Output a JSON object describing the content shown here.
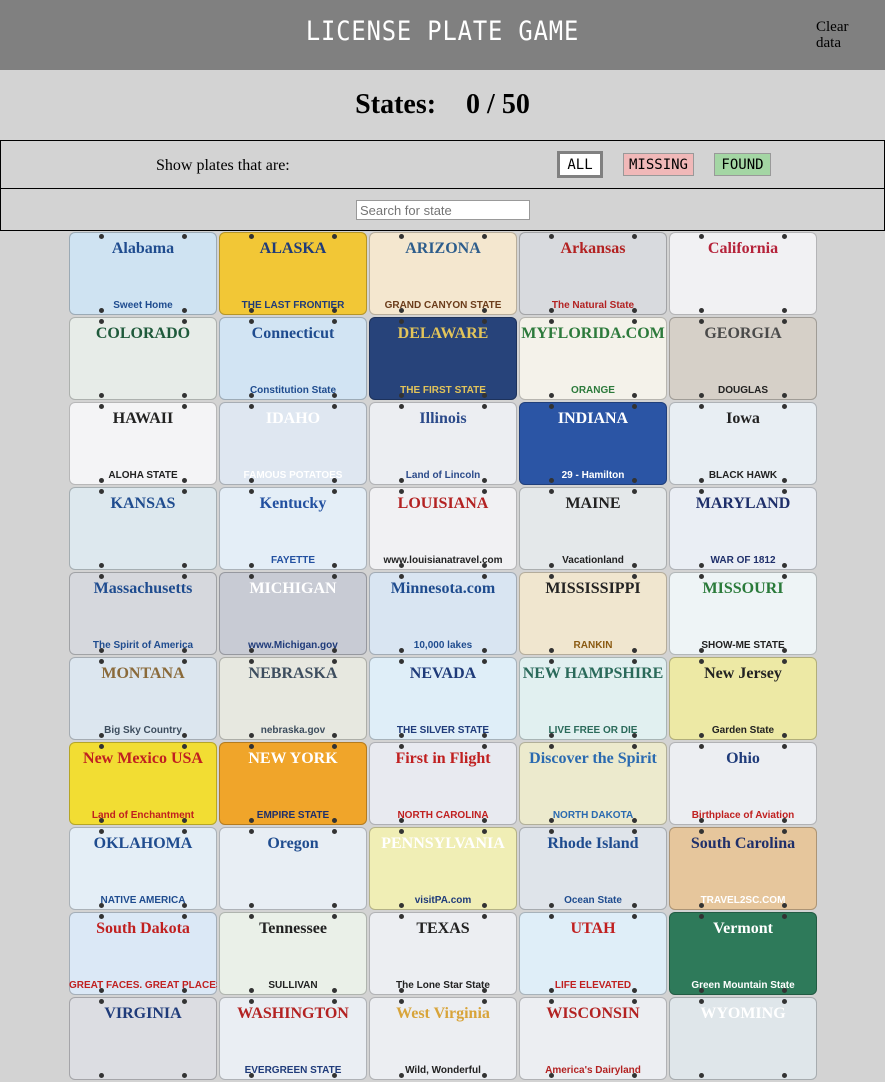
{
  "header": {
    "title": "License Plate Game",
    "clear_label": "Clear data"
  },
  "counter": {
    "label": "States:",
    "value": "0 / 50"
  },
  "filter": {
    "label": "Show plates that are:",
    "options": [
      {
        "label": "ALL"
      },
      {
        "label": "MISSING"
      },
      {
        "label": "FOUND"
      }
    ],
    "selected": "ALL"
  },
  "search": {
    "placeholder": "Search for state",
    "value": ""
  },
  "plates": [
    {
      "name": "Alabama",
      "slogan": "Sweet Home",
      "bg": "#cfe3f2",
      "fg": "#1f4c8f",
      "sc": "#1f4c8f"
    },
    {
      "name": "ALASKA",
      "slogan": "THE LAST FRONTIER",
      "bg": "#f2c736",
      "fg": "#1f3b7a",
      "sc": "#1f3b7a"
    },
    {
      "name": "ARIZONA",
      "slogan": "GRAND CANYON STATE",
      "bg": "#f4e7cf",
      "fg": "#2d5d8c",
      "sc": "#6b3c1a"
    },
    {
      "name": "Arkansas",
      "slogan": "The Natural State",
      "bg": "#d8dade",
      "fg": "#b32222",
      "sc": "#b32222"
    },
    {
      "name": "California",
      "slogan": "",
      "bg": "#f1f1f3",
      "fg": "#b5233a",
      "sc": "#1e3d8a"
    },
    {
      "name": "COLORADO",
      "slogan": "",
      "bg": "#e7ece8",
      "fg": "#1f5a3b",
      "sc": "#1f5a3b"
    },
    {
      "name": "Connecticut",
      "slogan": "Constitution State",
      "bg": "#d2e4f3",
      "fg": "#1f4c8f",
      "sc": "#1f4c8f"
    },
    {
      "name": "DELAWARE",
      "slogan": "THE FIRST STATE",
      "bg": "#27437a",
      "fg": "#e2c45a",
      "sc": "#e2c45a"
    },
    {
      "name": "MYFLORIDA.COM",
      "slogan": "ORANGE",
      "bg": "#f4f2ea",
      "fg": "#2c7a3b",
      "sc": "#2c7a3b"
    },
    {
      "name": "GEORGIA",
      "slogan": "DOUGLAS",
      "bg": "#d6d0c8",
      "fg": "#4a4a4a",
      "sc": "#222222"
    },
    {
      "name": "HAWAII",
      "slogan": "ALOHA STATE",
      "bg": "#f4f4f6",
      "fg": "#222222",
      "sc": "#222222"
    },
    {
      "name": "IDAHO",
      "slogan": "FAMOUS POTATOES",
      "bg": "#dfe7f1",
      "fg": "#ffffff",
      "sc": "#ffffff"
    },
    {
      "name": "Illinois",
      "slogan": "Land of Lincoln",
      "bg": "#eceef2",
      "fg": "#2b4a8a",
      "sc": "#2b4a8a"
    },
    {
      "name": "INDIANA",
      "slogan": "29 - Hamilton",
      "bg": "#2b55a5",
      "fg": "#ffffff",
      "sc": "#ffffff"
    },
    {
      "name": "Iowa",
      "slogan": "BLACK HAWK",
      "bg": "#e8eef3",
      "fg": "#222222",
      "sc": "#222222"
    },
    {
      "name": "KANSAS",
      "slogan": "",
      "bg": "#dde8ee",
      "fg": "#1f4c8f",
      "sc": "#1f4c8f"
    },
    {
      "name": "Kentucky",
      "slogan": "FAYETTE",
      "bg": "#e4eef7",
      "fg": "#2250a0",
      "sc": "#2250a0"
    },
    {
      "name": "LOUISIANA",
      "slogan": "www.louisianatravel.com",
      "bg": "#f1f1f3",
      "fg": "#b32222",
      "sc": "#222222"
    },
    {
      "name": "MAINE",
      "slogan": "Vacationland",
      "bg": "#e4e8ea",
      "fg": "#222222",
      "sc": "#222222"
    },
    {
      "name": "MARYLAND",
      "slogan": "WAR OF 1812",
      "bg": "#eaeef4",
      "fg": "#1f2f6a",
      "sc": "#1f2f6a"
    },
    {
      "name": "Massachusetts",
      "slogan": "The Spirit of America",
      "bg": "#d6d8dd",
      "fg": "#1f4c8f",
      "sc": "#1f4c8f"
    },
    {
      "name": "MICHIGAN",
      "slogan": "www.Michigan.gov",
      "bg": "#c8cbd4",
      "fg": "#ffffff",
      "sc": "#1f3b7a"
    },
    {
      "name": "Minnesota.com",
      "slogan": "10,000 lakes",
      "bg": "#d9e5f2",
      "fg": "#1f4c8f",
      "sc": "#1f4c8f"
    },
    {
      "name": "MISSISSIPPI",
      "slogan": "RANKIN",
      "bg": "#f0e6cf",
      "fg": "#222222",
      "sc": "#8a5a12"
    },
    {
      "name": "MISSOURI",
      "slogan": "SHOW-ME STATE",
      "bg": "#eef4f6",
      "fg": "#2a7a3a",
      "sc": "#222222"
    },
    {
      "name": "MONTANA",
      "slogan": "Big Sky Country",
      "bg": "#dce6ef",
      "fg": "#8a6a3a",
      "sc": "#3d4d5e"
    },
    {
      "name": "NEBRASKA",
      "slogan": "nebraska.gov",
      "bg": "#e7e8e0",
      "fg": "#3d4d5e",
      "sc": "#3d4d5e"
    },
    {
      "name": "NEVADA",
      "slogan": "THE SILVER STATE",
      "bg": "#dfeef8",
      "fg": "#1f3b7a",
      "sc": "#1f3b7a"
    },
    {
      "name": "NEW HAMPSHIRE",
      "slogan": "LIVE FREE OR DIE",
      "bg": "#e1f0f0",
      "fg": "#2a6a5a",
      "sc": "#2a6a5a"
    },
    {
      "name": "New Jersey",
      "slogan": "Garden State",
      "bg": "#ede9a5",
      "fg": "#222222",
      "sc": "#222222"
    },
    {
      "name": "New Mexico USA",
      "slogan": "Land of Enchantment",
      "bg": "#f2dd33",
      "fg": "#c02020",
      "sc": "#c02020"
    },
    {
      "name": "NEW YORK",
      "slogan": "EMPIRE STATE",
      "bg": "#f0a52a",
      "fg": "#ffffff",
      "sc": "#1f2f6a"
    },
    {
      "name": "First in Flight",
      "slogan": "NORTH CAROLINA",
      "bg": "#e8eaf0",
      "fg": "#c02020",
      "sc": "#c02020"
    },
    {
      "name": "Discover the Spirit",
      "slogan": "NORTH DAKOTA",
      "bg": "#eceacd",
      "fg": "#2a6ab0",
      "sc": "#2a6ab0"
    },
    {
      "name": "Ohio",
      "slogan": "Birthplace of Aviation",
      "bg": "#eceef2",
      "fg": "#1f3b7a",
      "sc": "#c02020"
    },
    {
      "name": "OKLAHOMA",
      "slogan": "NATIVE AMERICA",
      "bg": "#e4eef6",
      "fg": "#1f4c8f",
      "sc": "#1f4c8f"
    },
    {
      "name": "Oregon",
      "slogan": "",
      "bg": "#e8eef4",
      "fg": "#1f4c8f",
      "sc": "#1f4c8f"
    },
    {
      "name": "PENNSYLVANIA",
      "slogan": "visitPA.com",
      "bg": "#f0eeb5",
      "fg": "#ffffff",
      "sc": "#1f3b7a"
    },
    {
      "name": "Rhode Island",
      "slogan": "Ocean State",
      "bg": "#dfe4ea",
      "fg": "#1f4c8f",
      "sc": "#1f4c8f"
    },
    {
      "name": "South Carolina",
      "slogan": "TRAVEL2SC.COM",
      "bg": "#e6c69c",
      "fg": "#1f2f6a",
      "sc": "#ffffff"
    },
    {
      "name": "South Dakota",
      "slogan": "GREAT FACES. GREAT PLACES.",
      "bg": "#dbe8f6",
      "fg": "#c02020",
      "sc": "#c02020"
    },
    {
      "name": "Tennessee",
      "slogan": "SULLIVAN",
      "bg": "#eaf0e8",
      "fg": "#222222",
      "sc": "#222222"
    },
    {
      "name": "TEXAS",
      "slogan": "The Lone Star State",
      "bg": "#eceef2",
      "fg": "#222222",
      "sc": "#222222"
    },
    {
      "name": "UTAH",
      "slogan": "LIFE ELEVATED",
      "bg": "#dfeef8",
      "fg": "#c02020",
      "sc": "#c02020"
    },
    {
      "name": "Vermont",
      "slogan": "Green Mountain State",
      "bg": "#2e7a5a",
      "fg": "#ffffff",
      "sc": "#ffffff"
    },
    {
      "name": "VIRGINIA",
      "slogan": "",
      "bg": "#dcdde2",
      "fg": "#1f3b7a",
      "sc": "#1f3b7a"
    },
    {
      "name": "WASHINGTON",
      "slogan": "EVERGREEN STATE",
      "bg": "#eaeef3",
      "fg": "#b32222",
      "sc": "#1f3b7a"
    },
    {
      "name": "West Virginia",
      "slogan": "Wild, Wonderful",
      "bg": "#eceef2",
      "fg": "#d8a43a",
      "sc": "#222222"
    },
    {
      "name": "WISCONSIN",
      "slogan": "America's Dairyland",
      "bg": "#eceef2",
      "fg": "#b32222",
      "sc": "#b32222"
    },
    {
      "name": "WYOMING",
      "slogan": "",
      "bg": "#dfe6ea",
      "fg": "#ffffff",
      "sc": "#ffffff"
    }
  ]
}
